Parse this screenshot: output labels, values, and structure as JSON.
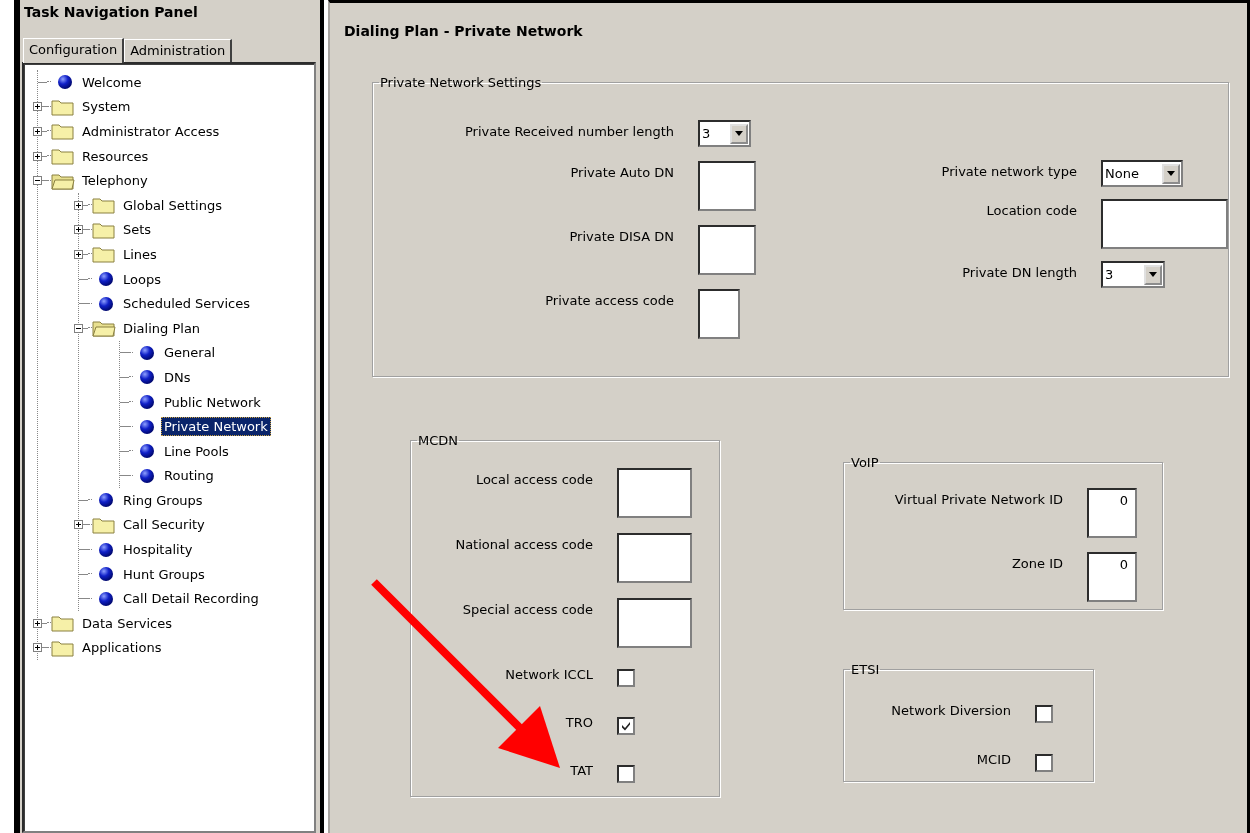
{
  "nav": {
    "title": "Task Navigation Panel",
    "tabs": [
      {
        "label": "Configuration",
        "selected": true
      },
      {
        "label": "Administration",
        "selected": false
      }
    ],
    "tree": [
      {
        "label": "Welcome",
        "kind": "leaf",
        "selected": false
      },
      {
        "label": "System",
        "kind": "folder",
        "expanded": false,
        "selected": false
      },
      {
        "label": "Administrator Access",
        "kind": "folder",
        "expanded": false,
        "selected": false
      },
      {
        "label": "Resources",
        "kind": "folder",
        "expanded": false,
        "selected": false
      },
      {
        "label": "Telephony",
        "kind": "folder",
        "expanded": true,
        "selected": false,
        "children": [
          {
            "label": "Global Settings",
            "kind": "folder",
            "expanded": false,
            "selected": false
          },
          {
            "label": "Sets",
            "kind": "folder",
            "expanded": false,
            "selected": false
          },
          {
            "label": "Lines",
            "kind": "folder",
            "expanded": false,
            "selected": false
          },
          {
            "label": "Loops",
            "kind": "leaf",
            "selected": false
          },
          {
            "label": "Scheduled Services",
            "kind": "leaf",
            "selected": false
          },
          {
            "label": "Dialing Plan",
            "kind": "folder",
            "expanded": true,
            "selected": false,
            "children": [
              {
                "label": "General",
                "kind": "leaf",
                "selected": false
              },
              {
                "label": "DNs",
                "kind": "leaf",
                "selected": false
              },
              {
                "label": "Public Network",
                "kind": "leaf",
                "selected": false
              },
              {
                "label": "Private Network",
                "kind": "leaf",
                "selected": true
              },
              {
                "label": "Line Pools",
                "kind": "leaf",
                "selected": false
              },
              {
                "label": "Routing",
                "kind": "leaf",
                "selected": false
              }
            ]
          },
          {
            "label": "Ring Groups",
            "kind": "leaf",
            "selected": false
          },
          {
            "label": "Call Security",
            "kind": "folder",
            "expanded": false,
            "selected": false
          },
          {
            "label": "Hospitality",
            "kind": "leaf",
            "selected": false
          },
          {
            "label": "Hunt Groups",
            "kind": "leaf",
            "selected": false
          },
          {
            "label": "Call Detail Recording",
            "kind": "leaf",
            "selected": false
          }
        ]
      },
      {
        "label": "Data Services",
        "kind": "folder",
        "expanded": false,
        "selected": false
      },
      {
        "label": "Applications",
        "kind": "folder",
        "expanded": false,
        "selected": false
      }
    ]
  },
  "page": {
    "title": "Dialing Plan - Private Network",
    "groups": [
      {
        "title": "Private Network Settings",
        "columns": [
          [
            {
              "label": "Private Received number length",
              "kind": "dropdown",
              "value": "3"
            },
            {
              "label": "Private Auto DN",
              "kind": "text"
            },
            {
              "label": "Private DISA DN",
              "kind": "text"
            },
            {
              "label": "Private access code",
              "kind": "text"
            }
          ],
          [
            {
              "label": "Private network type",
              "kind": "dropdown",
              "value": "None"
            },
            {
              "label": "Location code",
              "kind": "text"
            },
            {
              "label": "Private DN length",
              "kind": "dropdown",
              "value": "3"
            }
          ]
        ]
      },
      {
        "title": "MCDN",
        "columns": [
          [
            {
              "label": "Local access code",
              "kind": "text"
            },
            {
              "label": "National access code",
              "kind": "text"
            },
            {
              "label": "Special access code",
              "kind": "text"
            },
            {
              "label": "Network ICCL",
              "kind": "checkbox",
              "checked": false
            },
            {
              "label": "TRO",
              "kind": "checkbox",
              "checked": true
            },
            {
              "label": "TAT",
              "kind": "checkbox",
              "checked": false
            }
          ]
        ]
      },
      {
        "title": "VoIP",
        "columns": [
          [
            {
              "label": "Virtual Private Network ID",
              "kind": "text",
              "value": "0"
            },
            {
              "label": "Zone ID",
              "kind": "text",
              "value": "0"
            }
          ]
        ]
      },
      {
        "title": "ETSI",
        "columns": [
          [
            {
              "label": "Network Diversion",
              "kind": "checkbox",
              "checked": false
            },
            {
              "label": "MCID",
              "kind": "checkbox",
              "checked": false
            }
          ]
        ]
      }
    ]
  }
}
